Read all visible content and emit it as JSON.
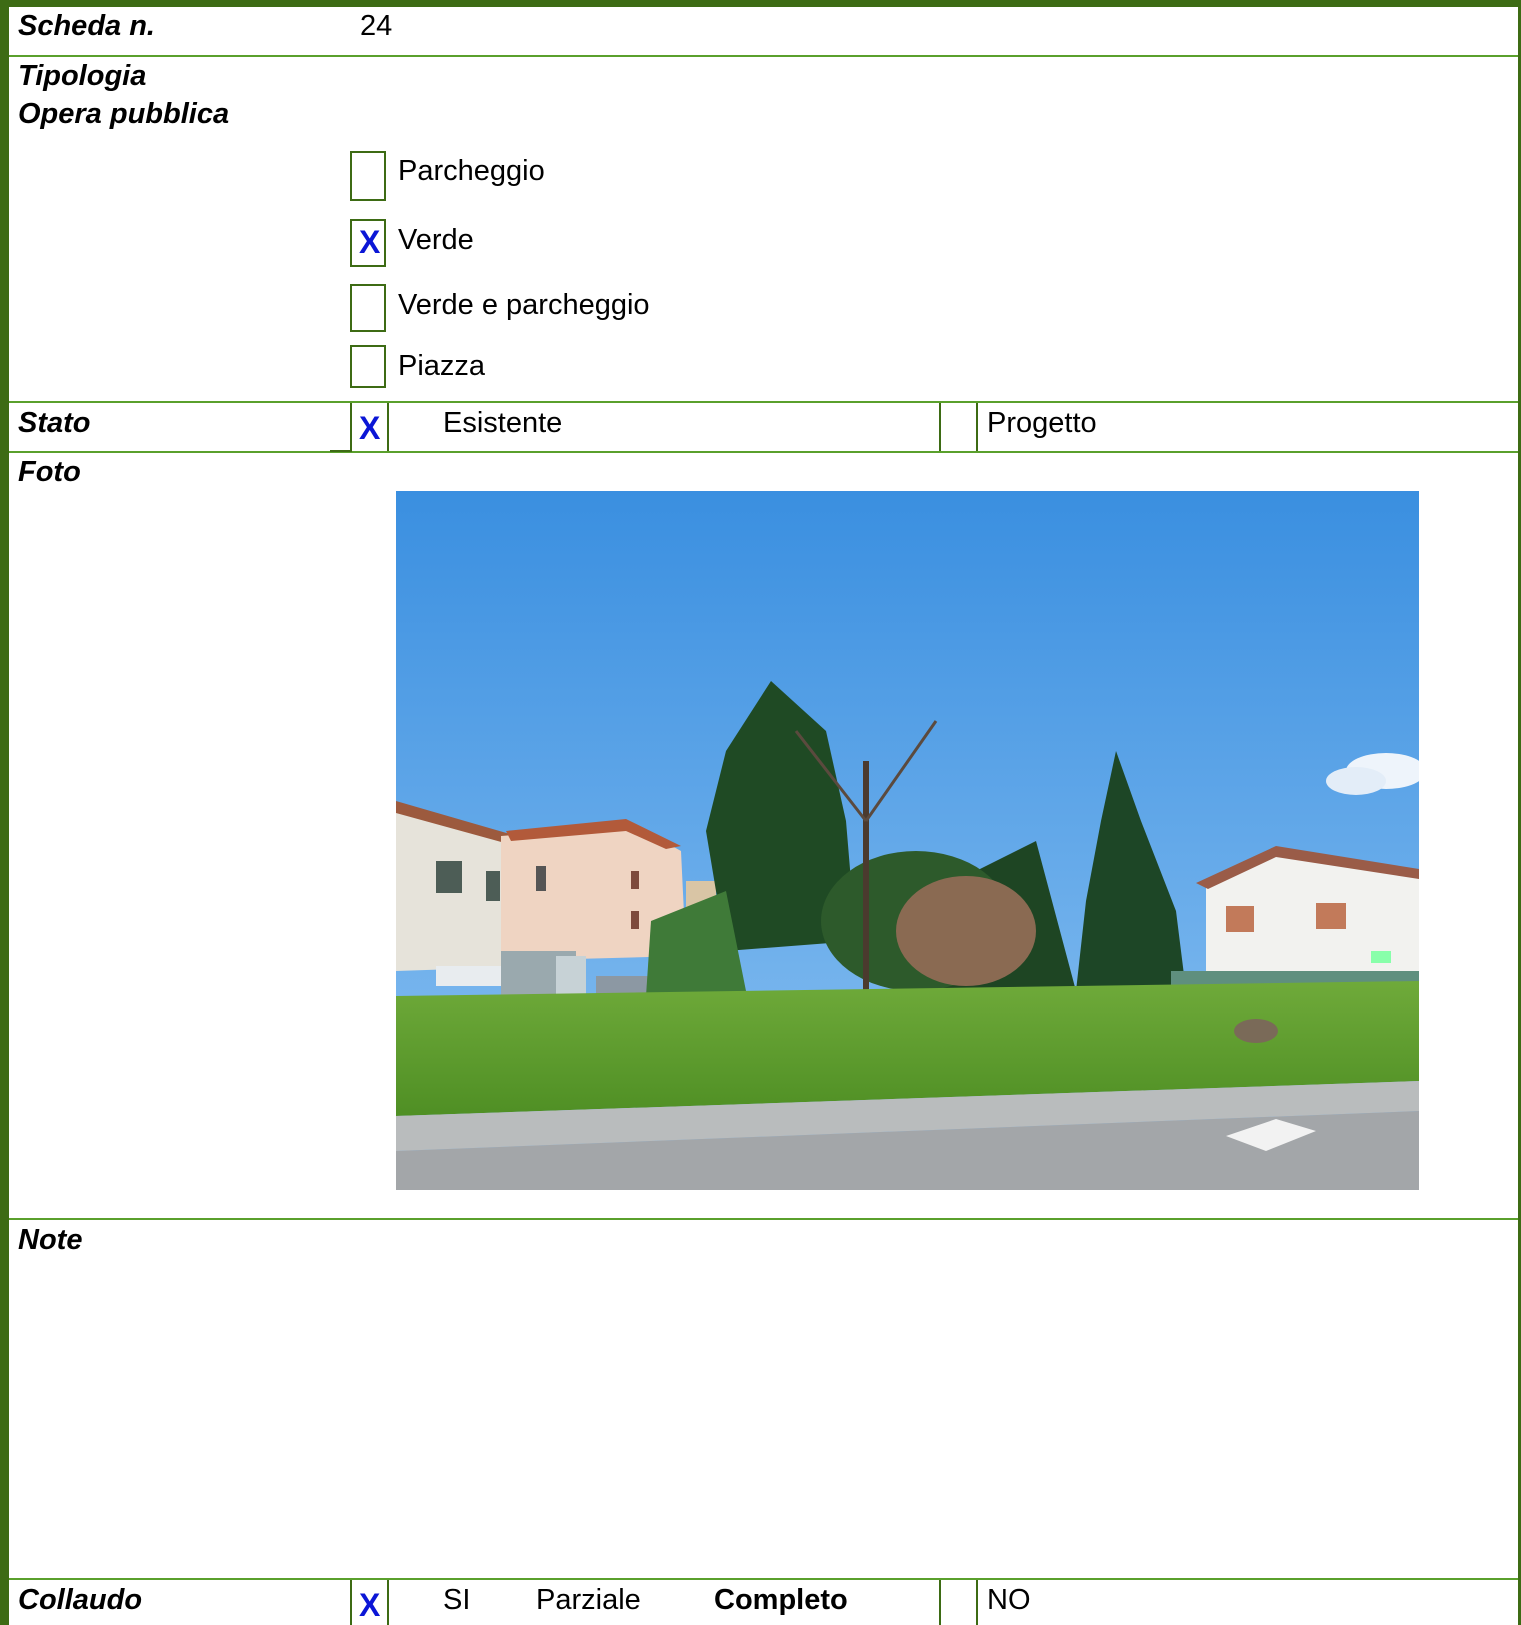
{
  "scheda": {
    "label": "Scheda n.",
    "value": "24"
  },
  "tipologia": {
    "label_line1": "Tipologia",
    "label_line2": "Opera pubblica",
    "options": [
      {
        "label": "Parcheggio",
        "checked": false
      },
      {
        "label": "Verde",
        "checked": true,
        "mark": "X"
      },
      {
        "label": "Verde e parcheggio",
        "checked": false
      },
      {
        "label": "Piazza",
        "checked": false
      }
    ]
  },
  "stato": {
    "label": "Stato",
    "mark": "X",
    "existing": "Esistente",
    "project": "Progetto"
  },
  "foto": {
    "label": "Foto",
    "image": "park-lawn-photo"
  },
  "note": {
    "label": "Note",
    "text": ""
  },
  "collaudo": {
    "label": "Collaudo",
    "mark": "X",
    "si": "SI",
    "parziale": "Parziale",
    "completo": "Completo",
    "no": "NO"
  },
  "colors": {
    "border_dark": "#3d6b14",
    "border_light": "#5aa02c",
    "mark": "#0b16d6"
  }
}
